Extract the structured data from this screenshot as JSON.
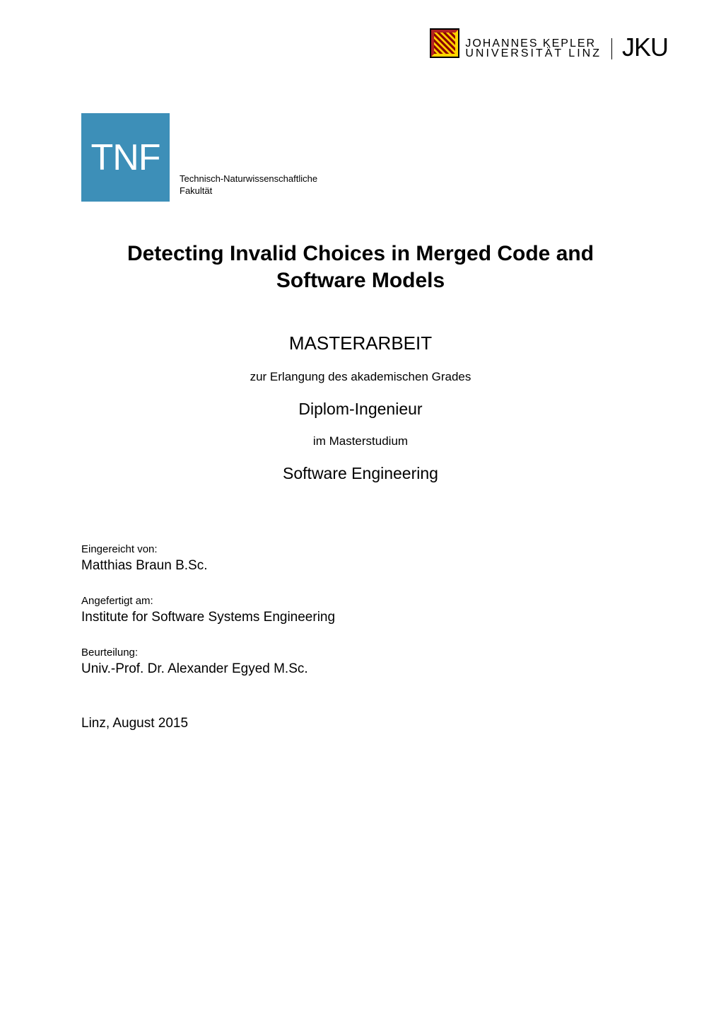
{
  "header": {
    "uni_line1": "JOHANNES KEPLER",
    "uni_line2": "UNIVERSITÄT LINZ",
    "jku": "JKU"
  },
  "tnf": {
    "box": "TNF",
    "label_line1": "Technisch-Naturwissenschaftliche",
    "label_line2": "Fakultät"
  },
  "title": {
    "main": "Detecting Invalid Choices in Merged Code and Software Models",
    "thesis_type": "MASTERARBEIT",
    "purpose": "zur Erlangung des akademischen Grades",
    "degree": "Diplom-Ingenieur",
    "program_prefix": "im Masterstudium",
    "program": "Software Engineering"
  },
  "details": {
    "submitted_by_label": "Eingereicht von:",
    "submitted_by_value": "Matthias Braun B.Sc.",
    "institute_label": "Angefertigt am:",
    "institute_value": "Institute for Software Systems Engineering",
    "evaluation_label": "Beurteilung:",
    "evaluation_value": "Univ.-Prof. Dr. Alexander Egyed M.Sc.",
    "date": "Linz, August 2015"
  }
}
